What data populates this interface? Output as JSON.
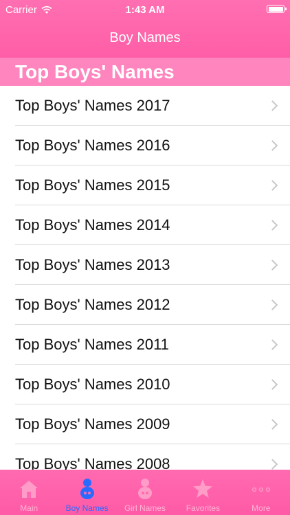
{
  "status": {
    "carrier": "Carrier",
    "time": "1:43 AM"
  },
  "nav": {
    "title": "Boy Names"
  },
  "section": {
    "title": "Top Boys' Names"
  },
  "items": [
    "Top Boys' Names 2017",
    "Top Boys' Names 2016",
    "Top Boys' Names 2015",
    "Top Boys' Names 2014",
    "Top Boys' Names 2013",
    "Top Boys' Names 2012",
    "Top Boys' Names 2011",
    "Top Boys' Names 2010",
    "Top Boys' Names 2009",
    "Top Boys' Names 2008"
  ],
  "tabs": [
    {
      "label": "Main",
      "icon": "house-icon",
      "active": false
    },
    {
      "label": "Boy Names",
      "icon": "baby-boy-icon",
      "active": true
    },
    {
      "label": "Girl Names",
      "icon": "baby-girl-icon",
      "active": false
    },
    {
      "label": "Favorites",
      "icon": "star-icon",
      "active": false
    },
    {
      "label": "More",
      "icon": "more-icon",
      "active": false
    }
  ],
  "colors": {
    "accent": "#ff5ea7",
    "section": "#ff85be",
    "active_tab": "#2a6bff",
    "inactive_tab": "#ffb4d6"
  }
}
